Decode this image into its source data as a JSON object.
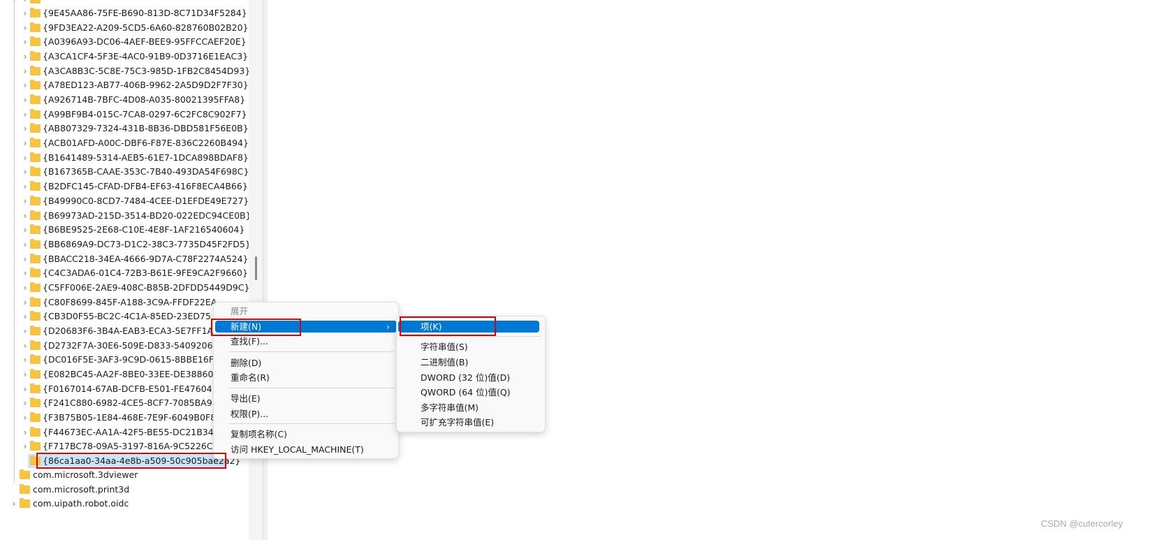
{
  "tree": {
    "guid_items": [
      "{9E45AA86-75FE-B690-813D-8C71D34F5284}",
      "{9FD3EA22-A209-5CD5-6A60-828760B02B20}",
      "{A0396A93-DC06-4AEF-BEE9-95FFCCAEF20E}",
      "{A3CA1CF4-5F3E-4AC0-91B9-0D3716E1EAC3}",
      "{A3CA8B3C-5C8E-75C3-985D-1FB2C8454D93}",
      "{A78ED123-AB77-406B-9962-2A5D9D2F7F30}",
      "{A926714B-7BFC-4D08-A035-80021395FFA8}",
      "{A99BF9B4-015C-7CA8-0297-6C2FC8C902F7}",
      "{AB807329-7324-431B-8B36-DBD581F56E0B}",
      "{ACB01AFD-A00C-DBF6-F87E-836C2260B494}",
      "{B1641489-5314-AEB5-61E7-1DCA898BDAF8}",
      "{B167365B-CAAE-353C-7B40-493DA54F698C}",
      "{B2DFC145-CFAD-DFB4-EF63-416F8ECA4B66}",
      "{B49990C0-8CD7-7484-4CEE-D1EFDE49E727}",
      "{B69973AD-215D-3514-BD20-022EDC94CE0B}",
      "{B6BE9525-2E68-C10E-4E8F-1AF216540604}",
      "{BB6869A9-DC73-D1C2-38C3-7735D45F2FD5}",
      "{BBACC218-34EA-4666-9D7A-C78F2274A524}",
      "{C4C3ADA6-01C4-72B3-B61E-9FE9CA2F9660}",
      "{C5FF006E-2AE9-408C-B85B-2DFDD5449D9C}",
      "{C80F8699-845F-A188-3C9A-FFDF22EA",
      "{CB3D0F55-BC2C-4C1A-85ED-23ED75",
      "{D20683F6-3B4A-EAB3-ECA3-5E7FF1A",
      "{D2732F7A-30E6-509E-D833-5409206",
      "{DC016F5E-3AF3-9C9D-0615-8BBE16F",
      "{E082BC45-AA2F-8BE0-33EE-DE38860",
      "{F0167014-67AB-DCFB-E501-FE47604",
      "{F241C880-6982-4CE5-8CF7-7085BA9",
      "{F3B75B05-1E84-468E-7E9F-6049B0F8",
      "{F44673EC-AA1A-42F5-BE55-DC21B34",
      "{F717BC78-09A5-3197-816A-9C5226C"
    ],
    "selected_item": "{86ca1aa0-34aa-4e8b-a509-50c905bae2a2}",
    "parent_items": [
      "com.microsoft.3dviewer",
      "com.microsoft.print3d",
      "com.uipath.robot.oidc"
    ]
  },
  "context_menu": {
    "expand": "展开",
    "new": "新建(N)",
    "find": "查找(F)...",
    "delete": "删除(D)",
    "rename": "重命名(R)",
    "export": "导出(E)",
    "permissions": "权限(P)...",
    "copy_key_name": "复制项名称(C)",
    "goto": "访问 HKEY_LOCAL_MACHINE(T)"
  },
  "submenu": {
    "key": "项(K)",
    "string_value": "字符串值(S)",
    "binary_value": "二进制值(B)",
    "dword_value": "DWORD (32 位)值(D)",
    "qword_value": "QWORD (64 位)值(Q)",
    "multi_string_value": "多字符串值(M)",
    "expandable_string_value": "可扩充字符串值(E)"
  },
  "colors": {
    "highlight": "#0078d4",
    "annotation": "#e00000",
    "selection": "#cce4f7"
  },
  "watermark": "CSDN @cutercorley"
}
